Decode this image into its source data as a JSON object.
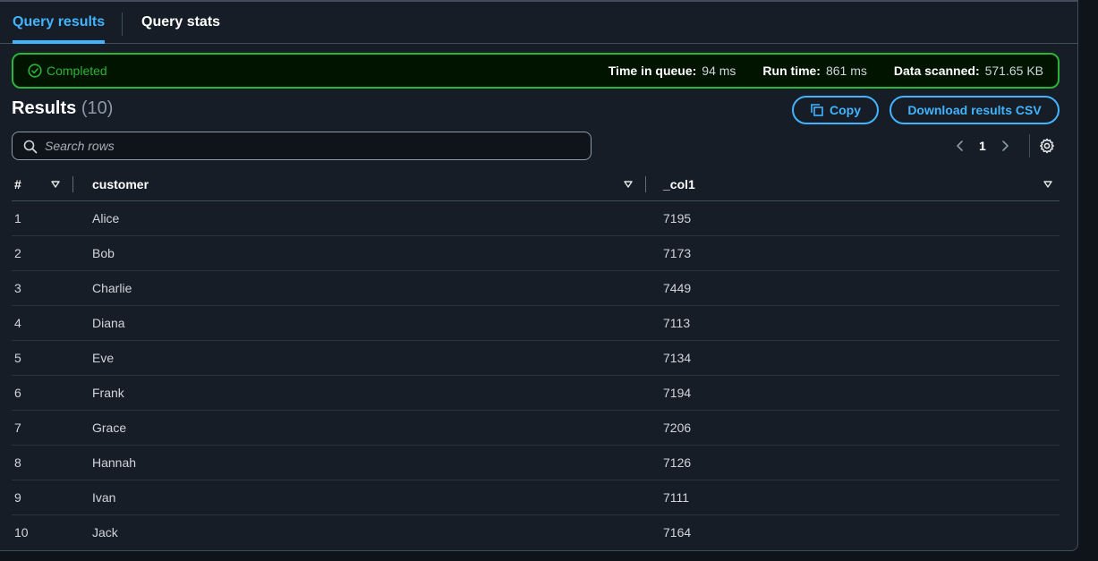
{
  "tabs": [
    {
      "label": "Query results",
      "active": true
    },
    {
      "label": "Query stats",
      "active": false
    }
  ],
  "status": {
    "label": "Completed",
    "time_in_queue_label": "Time in queue:",
    "time_in_queue_value": "94 ms",
    "run_time_label": "Run time:",
    "run_time_value": "861 ms",
    "data_scanned_label": "Data scanned:",
    "data_scanned_value": "571.65 KB",
    "color": "#2bb534"
  },
  "results": {
    "title": "Results",
    "count": "(10)",
    "copy_label": "Copy",
    "download_label": "Download results CSV"
  },
  "search": {
    "placeholder": "Search rows",
    "value": ""
  },
  "pagination": {
    "current_page": "1"
  },
  "table": {
    "headers": [
      "#",
      "customer",
      "_col1"
    ],
    "rows": [
      [
        "1",
        "Alice",
        "7195"
      ],
      [
        "2",
        "Bob",
        "7173"
      ],
      [
        "3",
        "Charlie",
        "7449"
      ],
      [
        "4",
        "Diana",
        "7113"
      ],
      [
        "5",
        "Eve",
        "7134"
      ],
      [
        "6",
        "Frank",
        "7194"
      ],
      [
        "7",
        "Grace",
        "7206"
      ],
      [
        "8",
        "Hannah",
        "7126"
      ],
      [
        "9",
        "Ivan",
        "7111"
      ],
      [
        "10",
        "Jack",
        "7164"
      ]
    ]
  },
  "colors": {
    "accent": "#42b4ff",
    "success": "#2bb534",
    "background": "#161d26"
  }
}
